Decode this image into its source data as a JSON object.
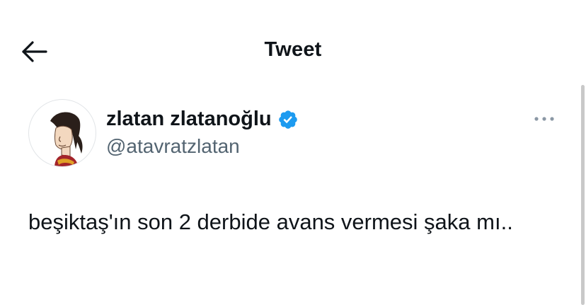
{
  "header": {
    "title": "Tweet",
    "back_icon": "arrow-left-icon"
  },
  "tweet": {
    "author": {
      "display_name": "zlatan zlatanoğlu",
      "handle": "@atavratzlatan",
      "verified": true,
      "verified_color": "#1d9bf0",
      "avatar_icon": "profile-illustration"
    },
    "more_icon": "more-options-icon",
    "text": "beşiktaş'ın son 2 derbide avans vermesi şaka mı.."
  },
  "colors": {
    "text_primary": "#0f1419",
    "text_secondary": "#536471",
    "verified_blue": "#1d9bf0",
    "icon_gray": "#8b98a5"
  }
}
